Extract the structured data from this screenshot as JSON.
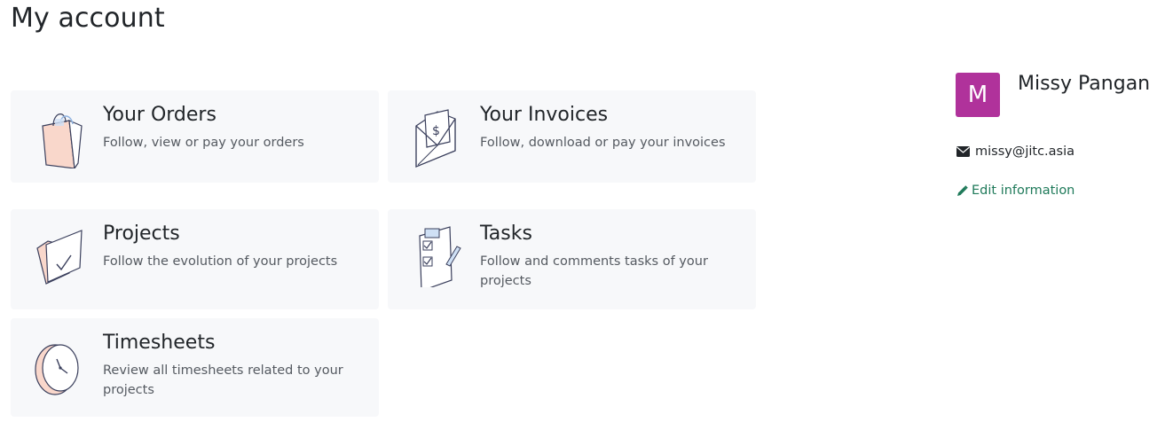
{
  "page": {
    "title": "My account"
  },
  "cards": {
    "orders": {
      "title": "Your Orders",
      "description": "Follow, view or pay your orders",
      "icon": "shopping-bag-icon"
    },
    "invoices": {
      "title": "Your Invoices",
      "description": "Follow, download or pay your invoices",
      "icon": "invoice-envelope-icon"
    },
    "projects": {
      "title": "Projects",
      "description": "Follow the evolution of your projects",
      "icon": "folder-check-icon"
    },
    "tasks": {
      "title": "Tasks",
      "description": "Follow and comments tasks of your projects",
      "icon": "checklist-clipboard-icon"
    },
    "timesheets": {
      "title": "Timesheets",
      "description": "Review all timesheets related to your projects",
      "icon": "clock-icon"
    }
  },
  "profile": {
    "avatar_letter": "M",
    "name": "Missy Pangan",
    "email": "missy@jitc.asia",
    "edit_label": "Edit information",
    "avatar_color": "#b0329b",
    "link_color": "#1f7a5a"
  }
}
